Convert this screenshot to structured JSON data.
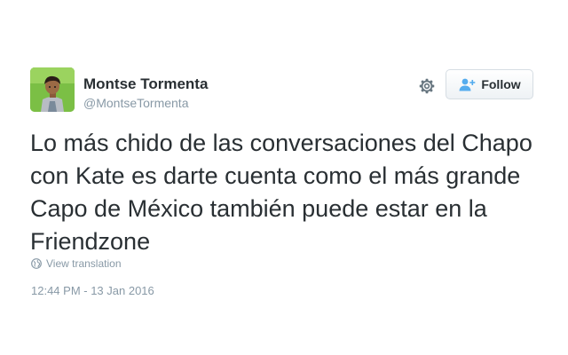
{
  "user": {
    "display_name": "Montse Tormenta",
    "handle": "@MontseTormenta",
    "avatar_icon": "avatar-character-icon"
  },
  "actions": {
    "settings_icon": "gear-icon",
    "follow_label": "Follow",
    "follow_icon": "add-person-icon"
  },
  "tweet": {
    "text": "Lo más chido de las conversaciones del Chapo con Kate es darte cuenta como el más grande Capo de México también puede estar en la Friendzone",
    "translation_label": "View translation",
    "translation_icon": "globe-icon",
    "timestamp": "12:44 PM - 13 Jan 2016"
  },
  "colors": {
    "text": "#292f33",
    "muted": "#8899a6",
    "accent": "#55acee"
  }
}
